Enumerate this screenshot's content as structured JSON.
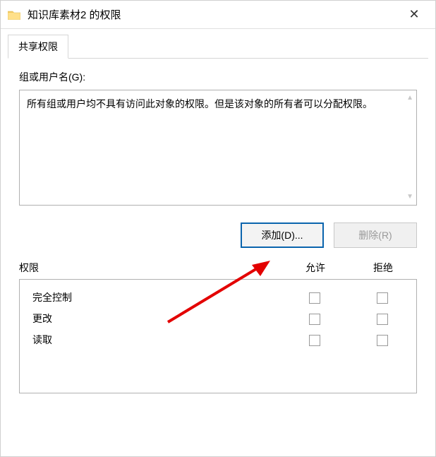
{
  "window": {
    "title": "知识库素材2 的权限",
    "close_glyph": "✕"
  },
  "tabs": {
    "share": "共享权限"
  },
  "group_label": "组或用户名(G):",
  "list_message": "所有组或用户均不具有访问此对象的权限。但是该对象的所有者可以分配权限。",
  "scroll_up": "▲",
  "scroll_down": "▼",
  "buttons": {
    "add": "添加(D)...",
    "remove": "删除(R)"
  },
  "perm_header": {
    "name": "权限",
    "allow": "允许",
    "deny": "拒绝"
  },
  "permissions": [
    {
      "label": "完全控制",
      "allow": false,
      "deny": false
    },
    {
      "label": "更改",
      "allow": false,
      "deny": false
    },
    {
      "label": "读取",
      "allow": false,
      "deny": false
    }
  ]
}
